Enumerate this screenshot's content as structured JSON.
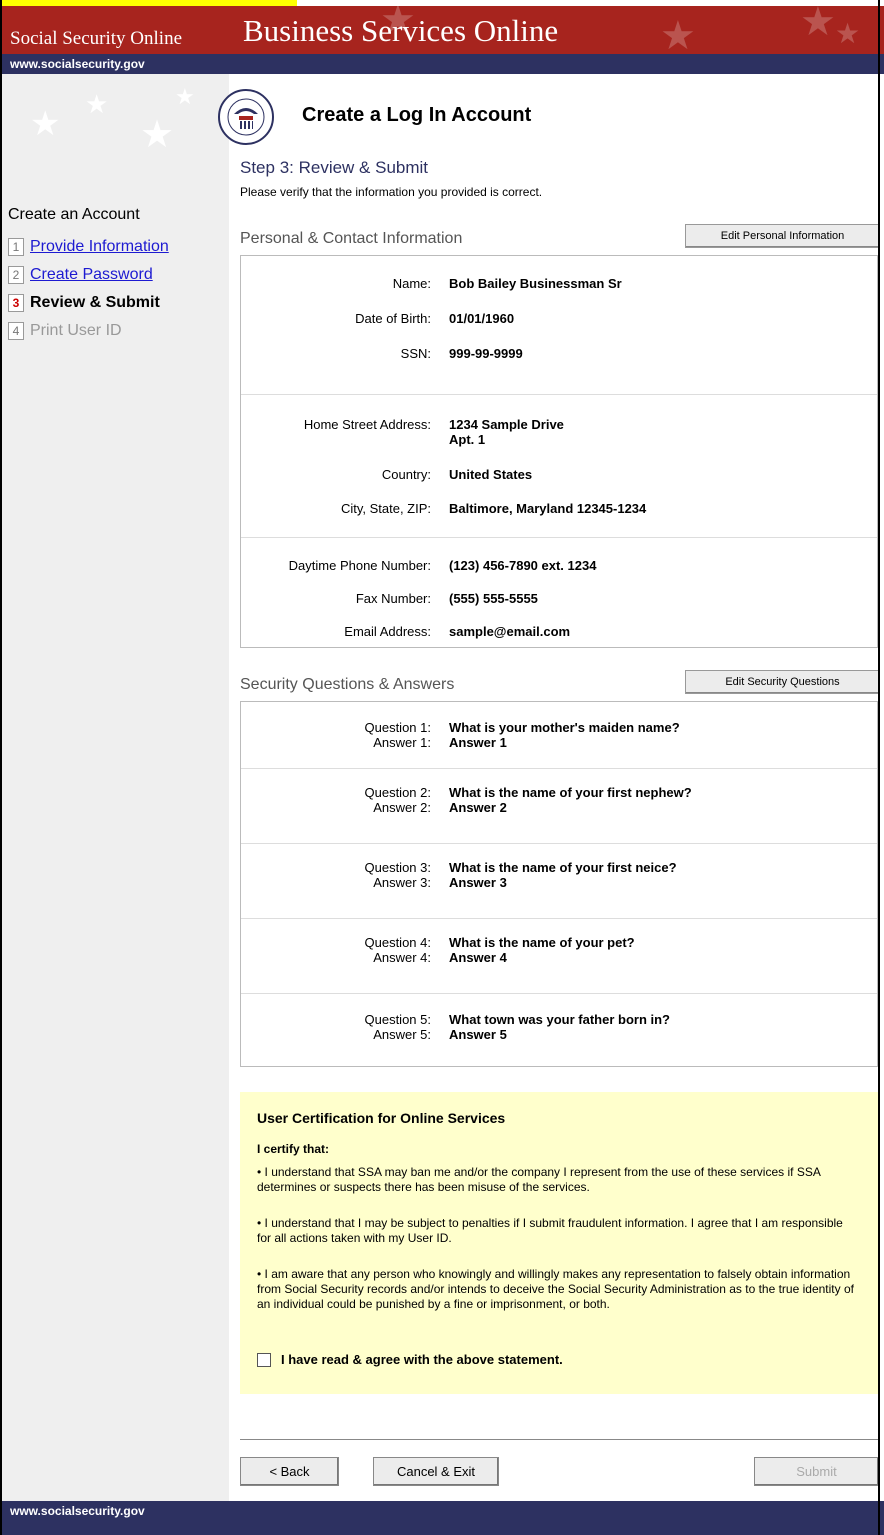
{
  "header": {
    "site_name": "Social Security Online",
    "banner_title": "Business Services Online",
    "url": "www.socialsecurity.gov"
  },
  "sidebar": {
    "title": "Create an Account",
    "steps": [
      {
        "num": "1",
        "label": "Provide Information"
      },
      {
        "num": "2",
        "label": "Create Password"
      },
      {
        "num": "3",
        "label": "Review & Submit"
      },
      {
        "num": "4",
        "label": "Print User ID"
      }
    ]
  },
  "main": {
    "title": "Create a Log In Account",
    "step_title": "Step 3:  Review & Submit",
    "intro": "Please verify that the information you provided is correct.",
    "personal": {
      "heading": "Personal & Contact Information",
      "edit_label": "Edit Personal Information",
      "name_label": "Name:",
      "name": "Bob Bailey Businessman Sr",
      "dob_label": "Date of Birth:",
      "dob": "01/01/1960",
      "ssn_label": "SSN:",
      "ssn": "999-99-9999",
      "address_label": "Home Street Address:",
      "address1": "1234 Sample Drive",
      "address2": "Apt. 1",
      "country_label": "Country:",
      "country": "United States",
      "csz_label": "City, State, ZIP:",
      "csz": "Baltimore, Maryland  12345-1234",
      "phone_label": "Daytime Phone Number:",
      "phone": "(123) 456-7890 ext. 1234",
      "fax_label": "Fax Number:",
      "fax": "(555) 555-5555",
      "email_label": "Email Address:",
      "email": "sample@email.com"
    },
    "security": {
      "heading": "Security Questions & Answers",
      "edit_label": "Edit Security Questions",
      "items": [
        {
          "q_label": "Question 1:",
          "q": "What is your mother's maiden name?",
          "a_label": "Answer 1:",
          "a": "Answer 1"
        },
        {
          "q_label": "Question 2:",
          "q": "What is the name of your first nephew?",
          "a_label": "Answer 2:",
          "a": "Answer 2"
        },
        {
          "q_label": "Question 3:",
          "q": "What is the name of your first neice?",
          "a_label": "Answer 3:",
          "a": "Answer 3"
        },
        {
          "q_label": "Question 4:",
          "q": "What is the name of your pet?",
          "a_label": "Answer 4:",
          "a": "Answer 4"
        },
        {
          "q_label": "Question 5:",
          "q": "What town was your father born in?",
          "a_label": "Answer 5:",
          "a": "Answer 5"
        }
      ]
    },
    "certification": {
      "title": "User Certification for Online Services",
      "subtitle": "I certify that:",
      "bullets": [
        "• I understand that SSA may ban me and/or the company I represent from the use of these services if SSA determines or suspects there has been misuse of the services.",
        "• I understand that I may be subject to penalties if I submit fraudulent information. I agree that I am responsible for all actions taken with my User ID.",
        "• I am aware that any person who knowingly and willingly makes any representation to falsely obtain information from Social Security records and/or intends to deceive the Social Security Administration as to the true identity of an individual could be punished by a fine or imprisonment, or both."
      ],
      "agree_label": "I have read & agree with the above statement."
    },
    "buttons": {
      "back": "< Back",
      "cancel": "Cancel & Exit",
      "submit": "Submit"
    }
  },
  "footer": {
    "url": "www.socialsecurity.gov"
  },
  "colors": {
    "header_red": "#a7241e",
    "navy": "#2d3161",
    "cert_bg": "#ffffcc",
    "link_blue": "#1d1ad1"
  }
}
